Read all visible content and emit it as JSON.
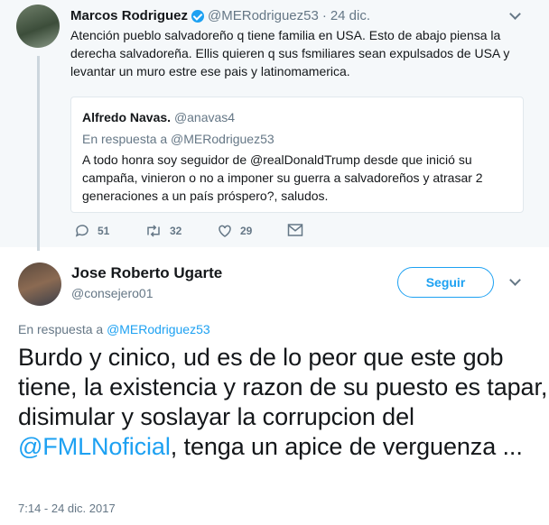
{
  "tweet1": {
    "name": "Marcos Rodriguez",
    "handle": "@MERodriguez53",
    "separator": "·",
    "date": "24 dic.",
    "text": "Atención pueblo salvadoreño q tiene familia en USA. Esto de abajo piensa la derecha salvadoreña. Ellis quieren q sus fsmiliares sean expulsados de USA y levantar un muro estre ese pais y latinomamerica.",
    "quote": {
      "name": "Alfredo Navas.",
      "handle": "@anavas4",
      "reply_to": "En respuesta a @MERodriguez53",
      "text": "A todo honra soy seguidor de @realDonaldTrump desde que inició su campaña, vinieron o no a imponer su guerra a salvadoreños y atrasar 2 generaciones a un país próspero?, saludos."
    },
    "actions": {
      "replies": "51",
      "retweets": "32",
      "likes": "29"
    }
  },
  "tweet2": {
    "name": "Jose Roberto Ugarte",
    "handle": "@consejero01",
    "follow_label": "Seguir",
    "reply_prefix": "En respuesta a ",
    "reply_handle": "@MERodriguez53",
    "text_before": "Burdo y cinico, ud es de lo peor que este gob tiene, la existencia y razon de su puesto es tapar, disimular y soslayar la corrupcion del ",
    "mention": "@FMLNoficial",
    "text_after": ", tenga un apice de verguenza ...",
    "timestamp": "7:14 - 24 dic. 2017"
  },
  "colors": {
    "accent": "#1da1f2",
    "muted": "#657786",
    "top_background": "#f5f8fa"
  },
  "icons": [
    "verified-badge-icon",
    "chevron-down-icon",
    "reply-icon",
    "retweet-icon",
    "like-icon",
    "message-icon"
  ]
}
